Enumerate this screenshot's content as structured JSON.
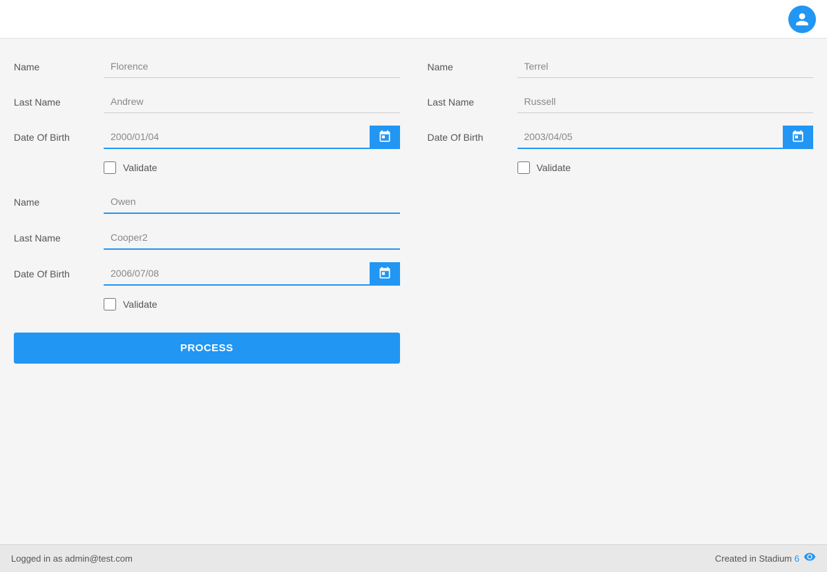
{
  "topBar": {
    "avatarIcon": "person-icon"
  },
  "leftColumn": {
    "group1": {
      "nameLabel": "Name",
      "nameValue": "Florence",
      "lastNameLabel": "Last Name",
      "lastNameValue": "Andrew",
      "dateOfBirthLabel": "Date Of Birth",
      "dateOfBirthValue": "2000/01/04",
      "validateLabel": "Validate"
    },
    "group2": {
      "nameLabel": "Name",
      "nameValue": "Owen",
      "lastNameLabel": "Last Name",
      "lastNameValue": "Cooper2",
      "dateOfBirthLabel": "Date Of Birth",
      "dateOfBirthValue": "2006/07/08",
      "validateLabel": "Validate"
    },
    "processButton": "PROCESS"
  },
  "rightColumn": {
    "nameLabel": "Name",
    "nameValue": "Terrel",
    "lastNameLabel": "Last Name",
    "lastNameValue": "Russell",
    "dateOfBirthLabel": "Date Of Birth",
    "dateOfBirthValue": "2003/04/05",
    "validateLabel": "Validate"
  },
  "statusBar": {
    "loggedIn": "Logged in as admin@test.com",
    "createdStadiumPrefix": "Created in Stadium",
    "stadiumNumber": "6"
  }
}
